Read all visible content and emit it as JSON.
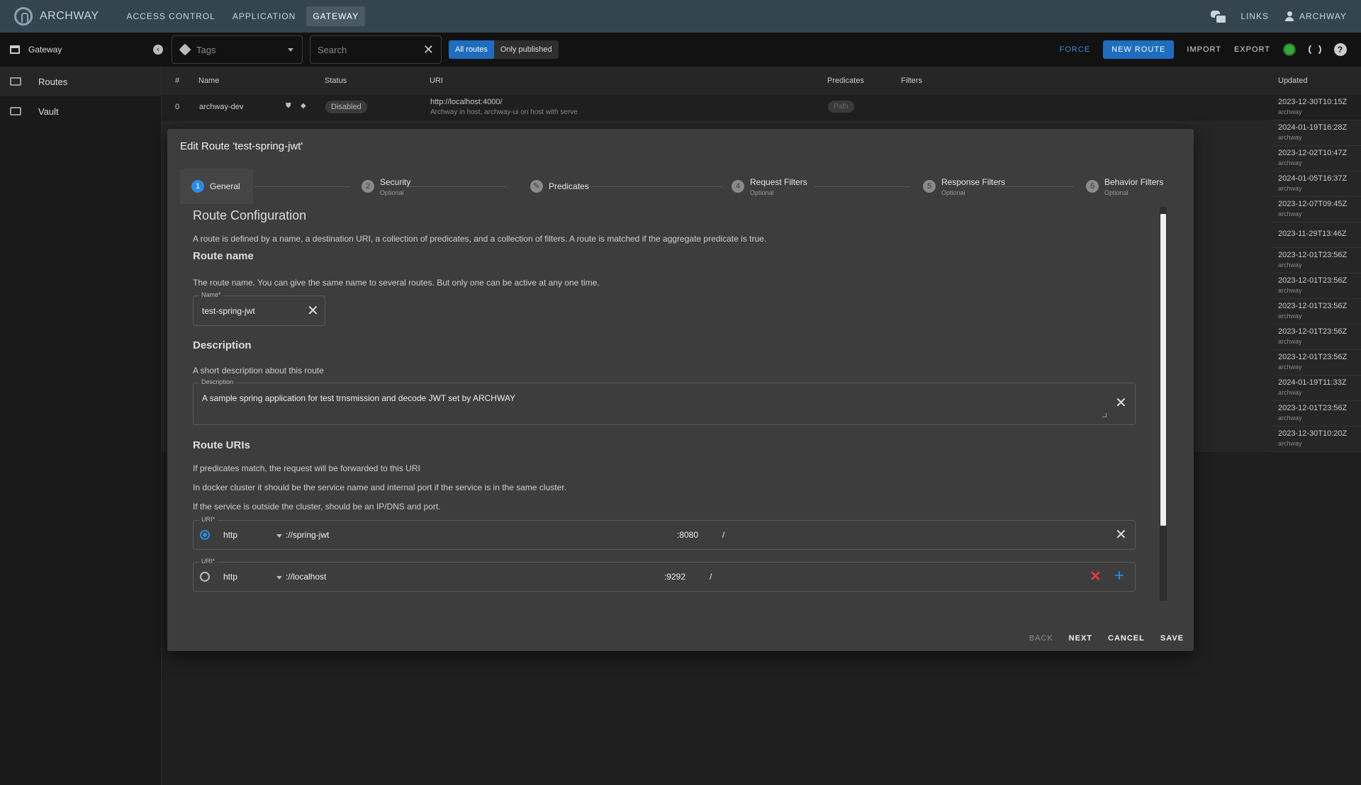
{
  "topbar": {
    "brand": "ARCHWAY",
    "nav": [
      "ACCESS CONTROL",
      "APPLICATION",
      "GATEWAY"
    ],
    "links_label": "LINKS",
    "user_label": "ARCHWAY"
  },
  "toolbar": {
    "section": "Gateway",
    "tags_placeholder": "Tags",
    "search_placeholder": "Search",
    "toggle_all": "All routes",
    "toggle_published": "Only published",
    "force": "FORCE",
    "new_route": "NEW ROUTE",
    "import": "IMPORT",
    "export": "EXPORT"
  },
  "sidebar": {
    "items": [
      "Routes",
      "Vault"
    ]
  },
  "table": {
    "headers": {
      "num": "#",
      "name": "Name",
      "status": "Status",
      "uri": "URI",
      "predicates": "Predicates",
      "filters": "Filters",
      "updated": "Updated"
    },
    "first_row": {
      "num": "0",
      "name": "archway-dev",
      "status": "Disabled",
      "uri": "http://localhost:4000/",
      "uri_desc": "Archway in host, archway-ui on host with serve",
      "predicate": "Path"
    },
    "updated": [
      {
        "date": "2023-12-30T10:15Z",
        "user": "archway"
      },
      {
        "date": "2024-01-19T16:28Z",
        "user": "archway"
      },
      {
        "date": "2023-12-02T10:47Z",
        "user": "archway"
      },
      {
        "date": "2024-01-05T16:37Z",
        "user": "archway"
      },
      {
        "date": "2023-12-07T09:45Z",
        "user": "archway"
      },
      {
        "date": "2023-11-29T13:46Z",
        "user": ""
      },
      {
        "date": "2023-12-01T23:56Z",
        "user": "archway"
      },
      {
        "date": "2023-12-01T23:56Z",
        "user": "archway"
      },
      {
        "date": "2023-12-01T23:56Z",
        "user": "archway"
      },
      {
        "date": "2023-12-01T23:56Z",
        "user": "archway"
      },
      {
        "date": "2023-12-01T23:56Z",
        "user": "archway"
      },
      {
        "date": "2024-01-19T11:33Z",
        "user": "archway"
      },
      {
        "date": "2023-12-01T23:56Z",
        "user": "archway"
      },
      {
        "date": "2023-12-30T10:20Z",
        "user": "archway"
      }
    ]
  },
  "dialog": {
    "title": "Edit Route 'test-spring-jwt'",
    "steps": [
      {
        "num": "1",
        "label": "General",
        "optional": ""
      },
      {
        "num": "2",
        "label": "Security",
        "optional": "Optional"
      },
      {
        "num": "3",
        "label": "Predicates",
        "optional": ""
      },
      {
        "num": "4",
        "label": "Request Filters",
        "optional": "Optional"
      },
      {
        "num": "5",
        "label": "Response Filters",
        "optional": "Optional"
      },
      {
        "num": "6",
        "label": "Behavior Filters",
        "optional": "Optional"
      }
    ],
    "section_title": "Route Configuration",
    "section_desc": "A route is defined by a name, a destination URI, a collection of predicates, and a collection of filters. A route is matched if the aggregate predicate is true.",
    "route_name": {
      "heading": "Route name",
      "desc": "The route name. You can give the same name to several routes. But only one can be active at any one time.",
      "label": "Name*",
      "value": "test-spring-jwt"
    },
    "description": {
      "heading": "Description",
      "desc": "A short description about this route",
      "label": "Description",
      "value": "A sample spring application for test trnsmission and decode JWT set by ARCHWAY"
    },
    "uris": {
      "heading": "Route URIs",
      "desc1": "If predicates match, the request will be forwarded to this URI",
      "desc2": "In docker cluster it should be the service name and internal port if the service is in the same cluster.",
      "desc3": "If the service is outside the cluster, should be an IP/DNS and port.",
      "items": [
        {
          "label": "URI*",
          "scheme": "http",
          "host": "://spring-jwt",
          "port": ":8080",
          "path": "/",
          "selected": true
        },
        {
          "label": "URI*",
          "scheme": "http",
          "host": "://localhost",
          "port": ":9292",
          "path": "/",
          "selected": false
        }
      ]
    },
    "actions": {
      "back": "BACK",
      "next": "NEXT",
      "cancel": "CANCEL",
      "save": "SAVE"
    }
  }
}
